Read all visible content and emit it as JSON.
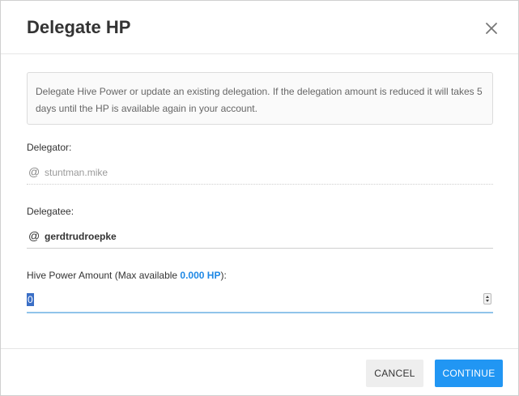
{
  "dialog": {
    "title": "Delegate HP",
    "close_icon": "close-icon"
  },
  "info": {
    "text": "Delegate Hive Power or update an existing delegation. If the delegation amount is reduced it will takes 5 days until the HP is available again in your account."
  },
  "delegator": {
    "label": "Delegator:",
    "at_symbol": "@",
    "value": "stuntman.mike"
  },
  "delegatee": {
    "label": "Delegatee:",
    "at_symbol": "@",
    "value": "gerdtrudroepke"
  },
  "amount": {
    "label_prefix": "Hive Power Amount (Max available ",
    "max_available": "0.000 HP",
    "label_suffix": "):",
    "value": "0"
  },
  "buttons": {
    "cancel": "CANCEL",
    "continue": "CONTINUE"
  },
  "colors": {
    "accent": "#2196f3",
    "accent_text": "#1e88e5",
    "input_focus_line": "#90c4ea",
    "selection": "#3b6fc6"
  }
}
